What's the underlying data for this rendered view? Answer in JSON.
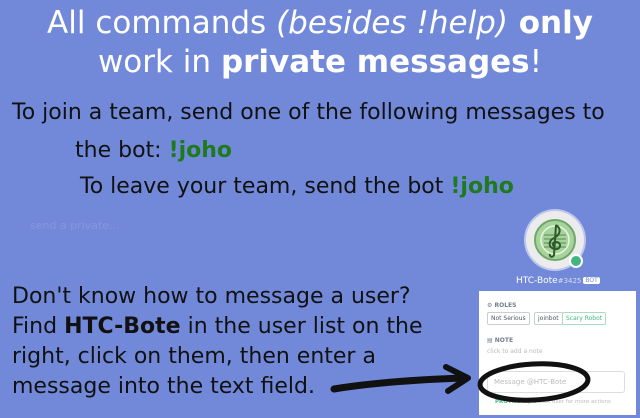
{
  "headline": {
    "line1_plain": "All commands ",
    "line1_italic": "(besides !help)",
    "line1_bold": " only",
    "line2_plain": "work in ",
    "line2_bold": "private messages",
    "line2_end": "!"
  },
  "join": {
    "line1": "To join a team, send one of the following messages to",
    "line2_plain": "the bot: ",
    "command": "!joho"
  },
  "leave": {
    "plain": "To leave your team, send the bot ",
    "command": "!joho"
  },
  "faint_text": "send a private...",
  "howto": {
    "line1": "Don't know how to message a user?",
    "line2_plain": "Find ",
    "line2_bold": "HTC-Bote",
    "line2_end": " in the user list on the",
    "line3": "right, click on them, then enter a",
    "line4": "message into the text field."
  },
  "profile": {
    "username": "HTC-Bote",
    "discriminator": "#3425",
    "bot_badge": "BOT",
    "roles_title": "ROLES",
    "roles": [
      "Not Serious",
      "joinbot",
      "Scary Robot"
    ],
    "note_title": "NOTE",
    "note_placeholder": "click to add a note",
    "message_placeholder": "Message @HTC-Bote",
    "protip_label": "PROTIP:",
    "protip_text": " Right click user for more actions",
    "status": "online",
    "avatar_icon": "treble-clef-icon"
  },
  "colors": {
    "background": "#7289da",
    "command_green": "#1f7a1f",
    "online": "#43b581",
    "annotation": "#111111"
  }
}
